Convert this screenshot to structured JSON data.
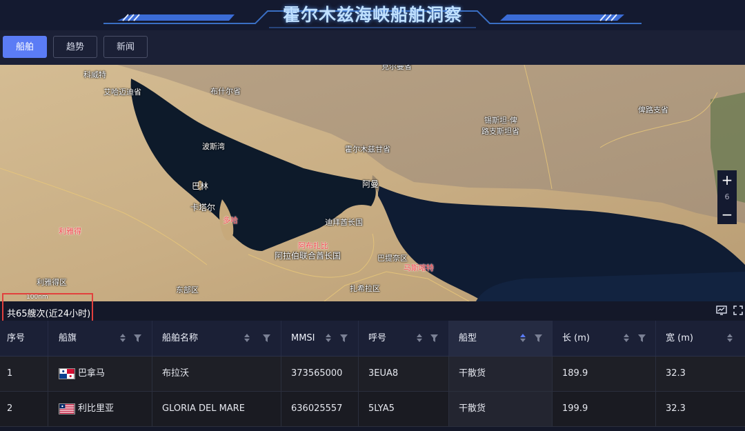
{
  "header": {
    "title": "霍尔木兹海峡船舶洞察"
  },
  "tabs": [
    {
      "label": "船舶",
      "active": true
    },
    {
      "label": "趋势",
      "active": false
    },
    {
      "label": "新闻",
      "active": false
    }
  ],
  "map": {
    "labels": {
      "kuwait": "科威特",
      "eastern_prov": "艾哈迈迪省",
      "bushehr": "布什尔省",
      "gulf": "波斯湾",
      "hormozgan": "霍尔木兹甘省",
      "bahrain": "巴林",
      "qatar": "卡塔尔",
      "doha": "多哈",
      "riyadh": "利雅得",
      "riyadh_region": "利雅得区",
      "abudhabi": "阿布扎比",
      "uae": "阿拉伯联合酋长国",
      "dubai": "迪拜酋长国",
      "oman": "阿曼",
      "batinah": "巴提奈区",
      "muscat": "马斯喀特",
      "sistan": "锡斯坦-俾路支斯坦省",
      "sistan_a": "锡斯坦-俾",
      "sistan_b": "路支斯坦省",
      "baluchistan": "俾路支省",
      "eastern_region": "东部区",
      "najran": "扎希拉区",
      "north_top": "克尔曼省"
    },
    "zoom_level": "6",
    "zoom_in": "+",
    "zoom_out": "−",
    "scale": "100nm"
  },
  "summary": {
    "count_text": "共65艘次(近24小时)"
  },
  "table": {
    "columns": [
      {
        "label": "序号"
      },
      {
        "label": "船旗"
      },
      {
        "label": "船舶名称"
      },
      {
        "label": "MMSI"
      },
      {
        "label": "呼号"
      },
      {
        "label": "船型"
      },
      {
        "label": "长 (m)"
      },
      {
        "label": "宽 (m)"
      }
    ],
    "rows": [
      {
        "index": "1",
        "flag": "巴拿马",
        "flag_icon": "panama-flag-icon",
        "name": "布拉沃",
        "mmsi": "373565000",
        "callsign": "3EUA8",
        "type": "干散货",
        "length": "189.9",
        "width": "32.3"
      },
      {
        "index": "2",
        "flag": "利比里亚",
        "flag_icon": "liberia-flag-icon",
        "name": "GLORIA DEL MARE",
        "mmsi": "636025557",
        "callsign": "5LYA5",
        "type": "干散货",
        "length": "199.9",
        "width": "32.3"
      }
    ]
  },
  "colors": {
    "accent": "#5b7cf5",
    "highlight_box": "#e2403d",
    "sea": "#0f1c33"
  }
}
